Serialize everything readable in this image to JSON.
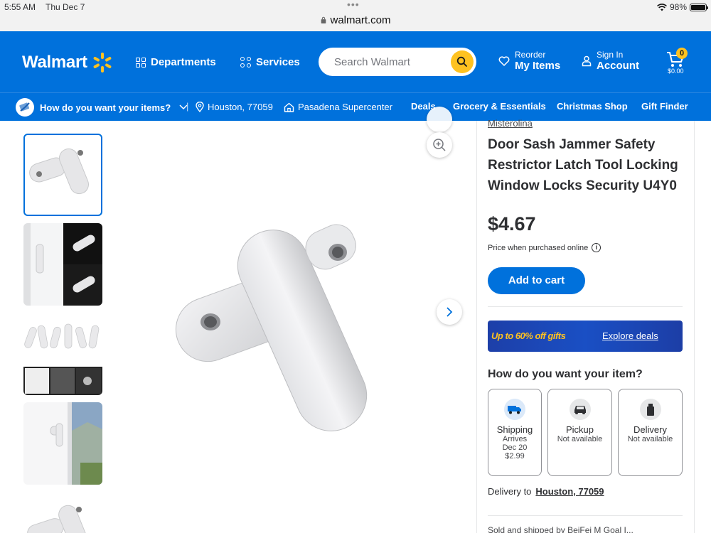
{
  "status_bar": {
    "time": "5:55 AM",
    "date": "Thu Dec 7",
    "battery": "98%"
  },
  "url_bar": {
    "domain": "walmart.com"
  },
  "header": {
    "logo": "Walmart",
    "departments": "Departments",
    "services": "Services",
    "search_placeholder": "Search Walmart",
    "reorder_small": "Reorder",
    "reorder_big": "My Items",
    "signin_small": "Sign In",
    "signin_big": "Account",
    "cart_count": "0",
    "cart_total": "$0.00"
  },
  "subnav": {
    "question": "How do you want your items?",
    "location": "Houston, 77059",
    "store": "Pasadena Supercenter",
    "links": [
      "Deals",
      "Grocery & Essentials",
      "Christmas Shop",
      "Gift Finder"
    ]
  },
  "product": {
    "brand": "Misterolina",
    "title": "Door Sash Jammer Safety Restrictor Latch Tool Locking Window Locks Security U4Y0",
    "price": "$4.67",
    "price_note": "Price when purchased online",
    "add_to_cart": "Add to cart"
  },
  "promo": {
    "text": "Up to 60% off gifts",
    "link": "Explore deals"
  },
  "fulfillment": {
    "heading": "How do you want your item?",
    "options": [
      {
        "name": "Shipping",
        "line1": "Arrives",
        "line2": "Dec 20",
        "line3": "$2.99"
      },
      {
        "name": "Pickup",
        "line1": "Not available",
        "line2": "",
        "line3": ""
      },
      {
        "name": "Delivery",
        "line1": "Not available",
        "line2": "",
        "line3": ""
      }
    ],
    "delivery_label": "Delivery to",
    "delivery_location": "Houston, 77059",
    "seller_line": "Sold and shipped by BeiFei M Goal I..."
  },
  "colors": {
    "brand_blue": "#0071dc",
    "spark_yellow": "#ffc220"
  }
}
